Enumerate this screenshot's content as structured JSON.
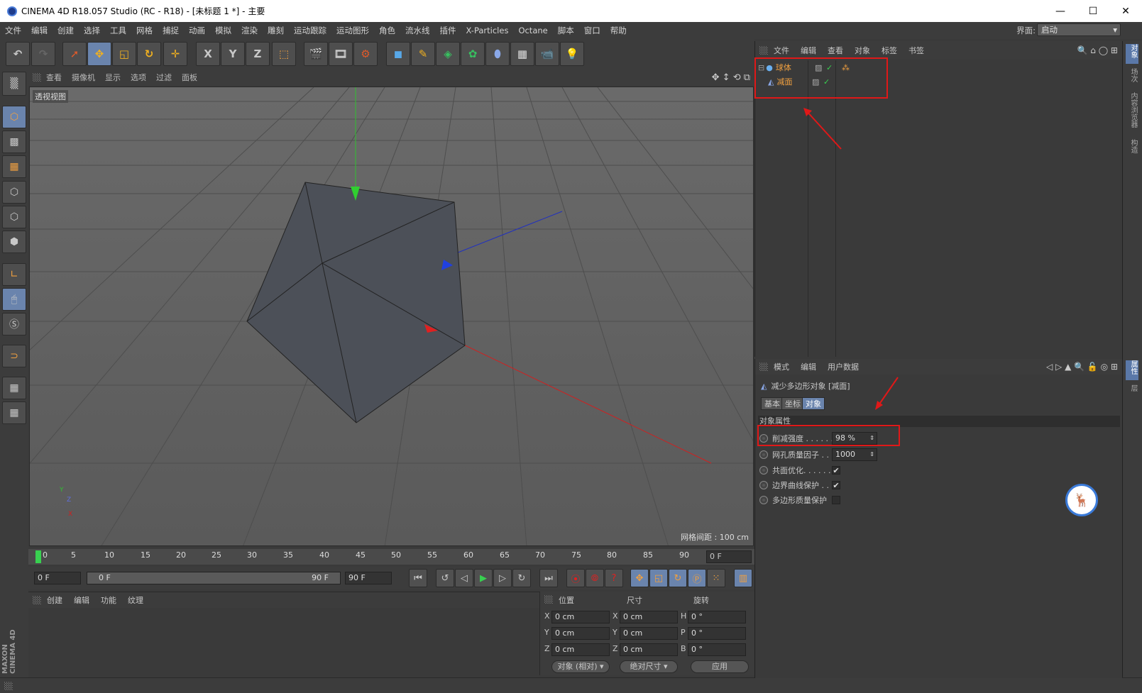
{
  "window": {
    "title": "CINEMA 4D R18.057 Studio (RC - R18) - [未标题 1 *] - 主要",
    "minimize": "—",
    "maximize": "☐",
    "close": "✕"
  },
  "menubar": {
    "items": [
      "文件",
      "编辑",
      "创建",
      "选择",
      "工具",
      "网格",
      "捕捉",
      "动画",
      "模拟",
      "渲染",
      "雕刻",
      "运动跟踪",
      "运动图形",
      "角色",
      "流水线",
      "插件",
      "X-Particles",
      "Octane",
      "脚本",
      "窗口",
      "帮助"
    ],
    "layout_label": "界面:",
    "layout_value": "启动"
  },
  "toolbar": {
    "icons": [
      "undo-icon",
      "redo-icon",
      "live-selection-icon",
      "move-icon",
      "scale-icon",
      "rotate-icon",
      "move-alt-icon",
      "x-axis-icon",
      "y-axis-icon",
      "z-axis-icon",
      "world-coord-icon",
      "render-view-icon",
      "render-picture-viewer-icon",
      "render-settings-icon",
      "cube-icon",
      "pen-icon",
      "subdivision-icon",
      "cloner-icon",
      "deformer-icon",
      "floor-icon",
      "camera-icon",
      "light-icon"
    ],
    "x_label": "X",
    "y_label": "Y",
    "z_label": "Z"
  },
  "viewport": {
    "menu": [
      "查看",
      "摄像机",
      "显示",
      "选项",
      "过滤",
      "面板"
    ],
    "view_label": "透视视图",
    "grid_spacing": "网格间距 : 100 cm"
  },
  "timeline": {
    "ticks": [
      "0",
      "5",
      "10",
      "15",
      "20",
      "25",
      "30",
      "35",
      "40",
      "45",
      "50",
      "55",
      "60",
      "65",
      "70",
      "75",
      "80",
      "85",
      "90"
    ],
    "current_frame": "0 F"
  },
  "transport": {
    "start_frame": "0 F",
    "range_start": "0 F",
    "range_end": "90 F",
    "end_frame": "90 F"
  },
  "material_panel": {
    "menu": [
      "创建",
      "编辑",
      "功能",
      "纹理"
    ]
  },
  "coord_panel": {
    "headers": [
      "位置",
      "尺寸",
      "旋转"
    ],
    "rows": [
      {
        "axis": "X",
        "pos": "0 cm",
        "size_axis": "X",
        "size": "0 cm",
        "rot_axis": "H",
        "rot": "0 °"
      },
      {
        "axis": "Y",
        "pos": "0 cm",
        "size_axis": "Y",
        "size": "0 cm",
        "rot_axis": "P",
        "rot": "0 °"
      },
      {
        "axis": "Z",
        "pos": "0 cm",
        "size_axis": "Z",
        "size": "0 cm",
        "rot_axis": "B",
        "rot": "0 °"
      }
    ],
    "mode": "对象 (相对)",
    "size_mode": "绝对尺寸",
    "apply": "应用"
  },
  "object_panel": {
    "menu": [
      "文件",
      "编辑",
      "查看",
      "对象",
      "标签",
      "书签"
    ],
    "objects": [
      {
        "name": "球体",
        "icon": "sphere-icon"
      },
      {
        "name": "减面",
        "icon": "polygon-reduction-icon"
      }
    ]
  },
  "attr_panel": {
    "menu": [
      "模式",
      "编辑",
      "用户数据"
    ],
    "object_title": "减少多边形对象 [减面]",
    "tabs": [
      "基本",
      "坐标",
      "对象"
    ],
    "section": "对象属性",
    "rows": [
      {
        "label": "削减强度 . . . . . .",
        "value": "98 %",
        "type": "field"
      },
      {
        "label": "网孔质量因子 . .",
        "value": "1000",
        "type": "field"
      },
      {
        "label": "共面优化. . . . . .",
        "value": "✔",
        "type": "check"
      },
      {
        "label": "边界曲线保护 . .",
        "value": "✔",
        "type": "check"
      },
      {
        "label": "多边形质量保护",
        "value": "",
        "type": "check"
      }
    ]
  },
  "right_tabs": [
    "对象",
    "场次",
    "内容浏览器",
    "构造",
    "属性",
    "层"
  ],
  "watermark": "🦌",
  "branding": "MAXON CINEMA 4D",
  "colors": {
    "accent": "#6a84ad",
    "object_name": "#f0a040",
    "annotation_red": "#e01818"
  }
}
